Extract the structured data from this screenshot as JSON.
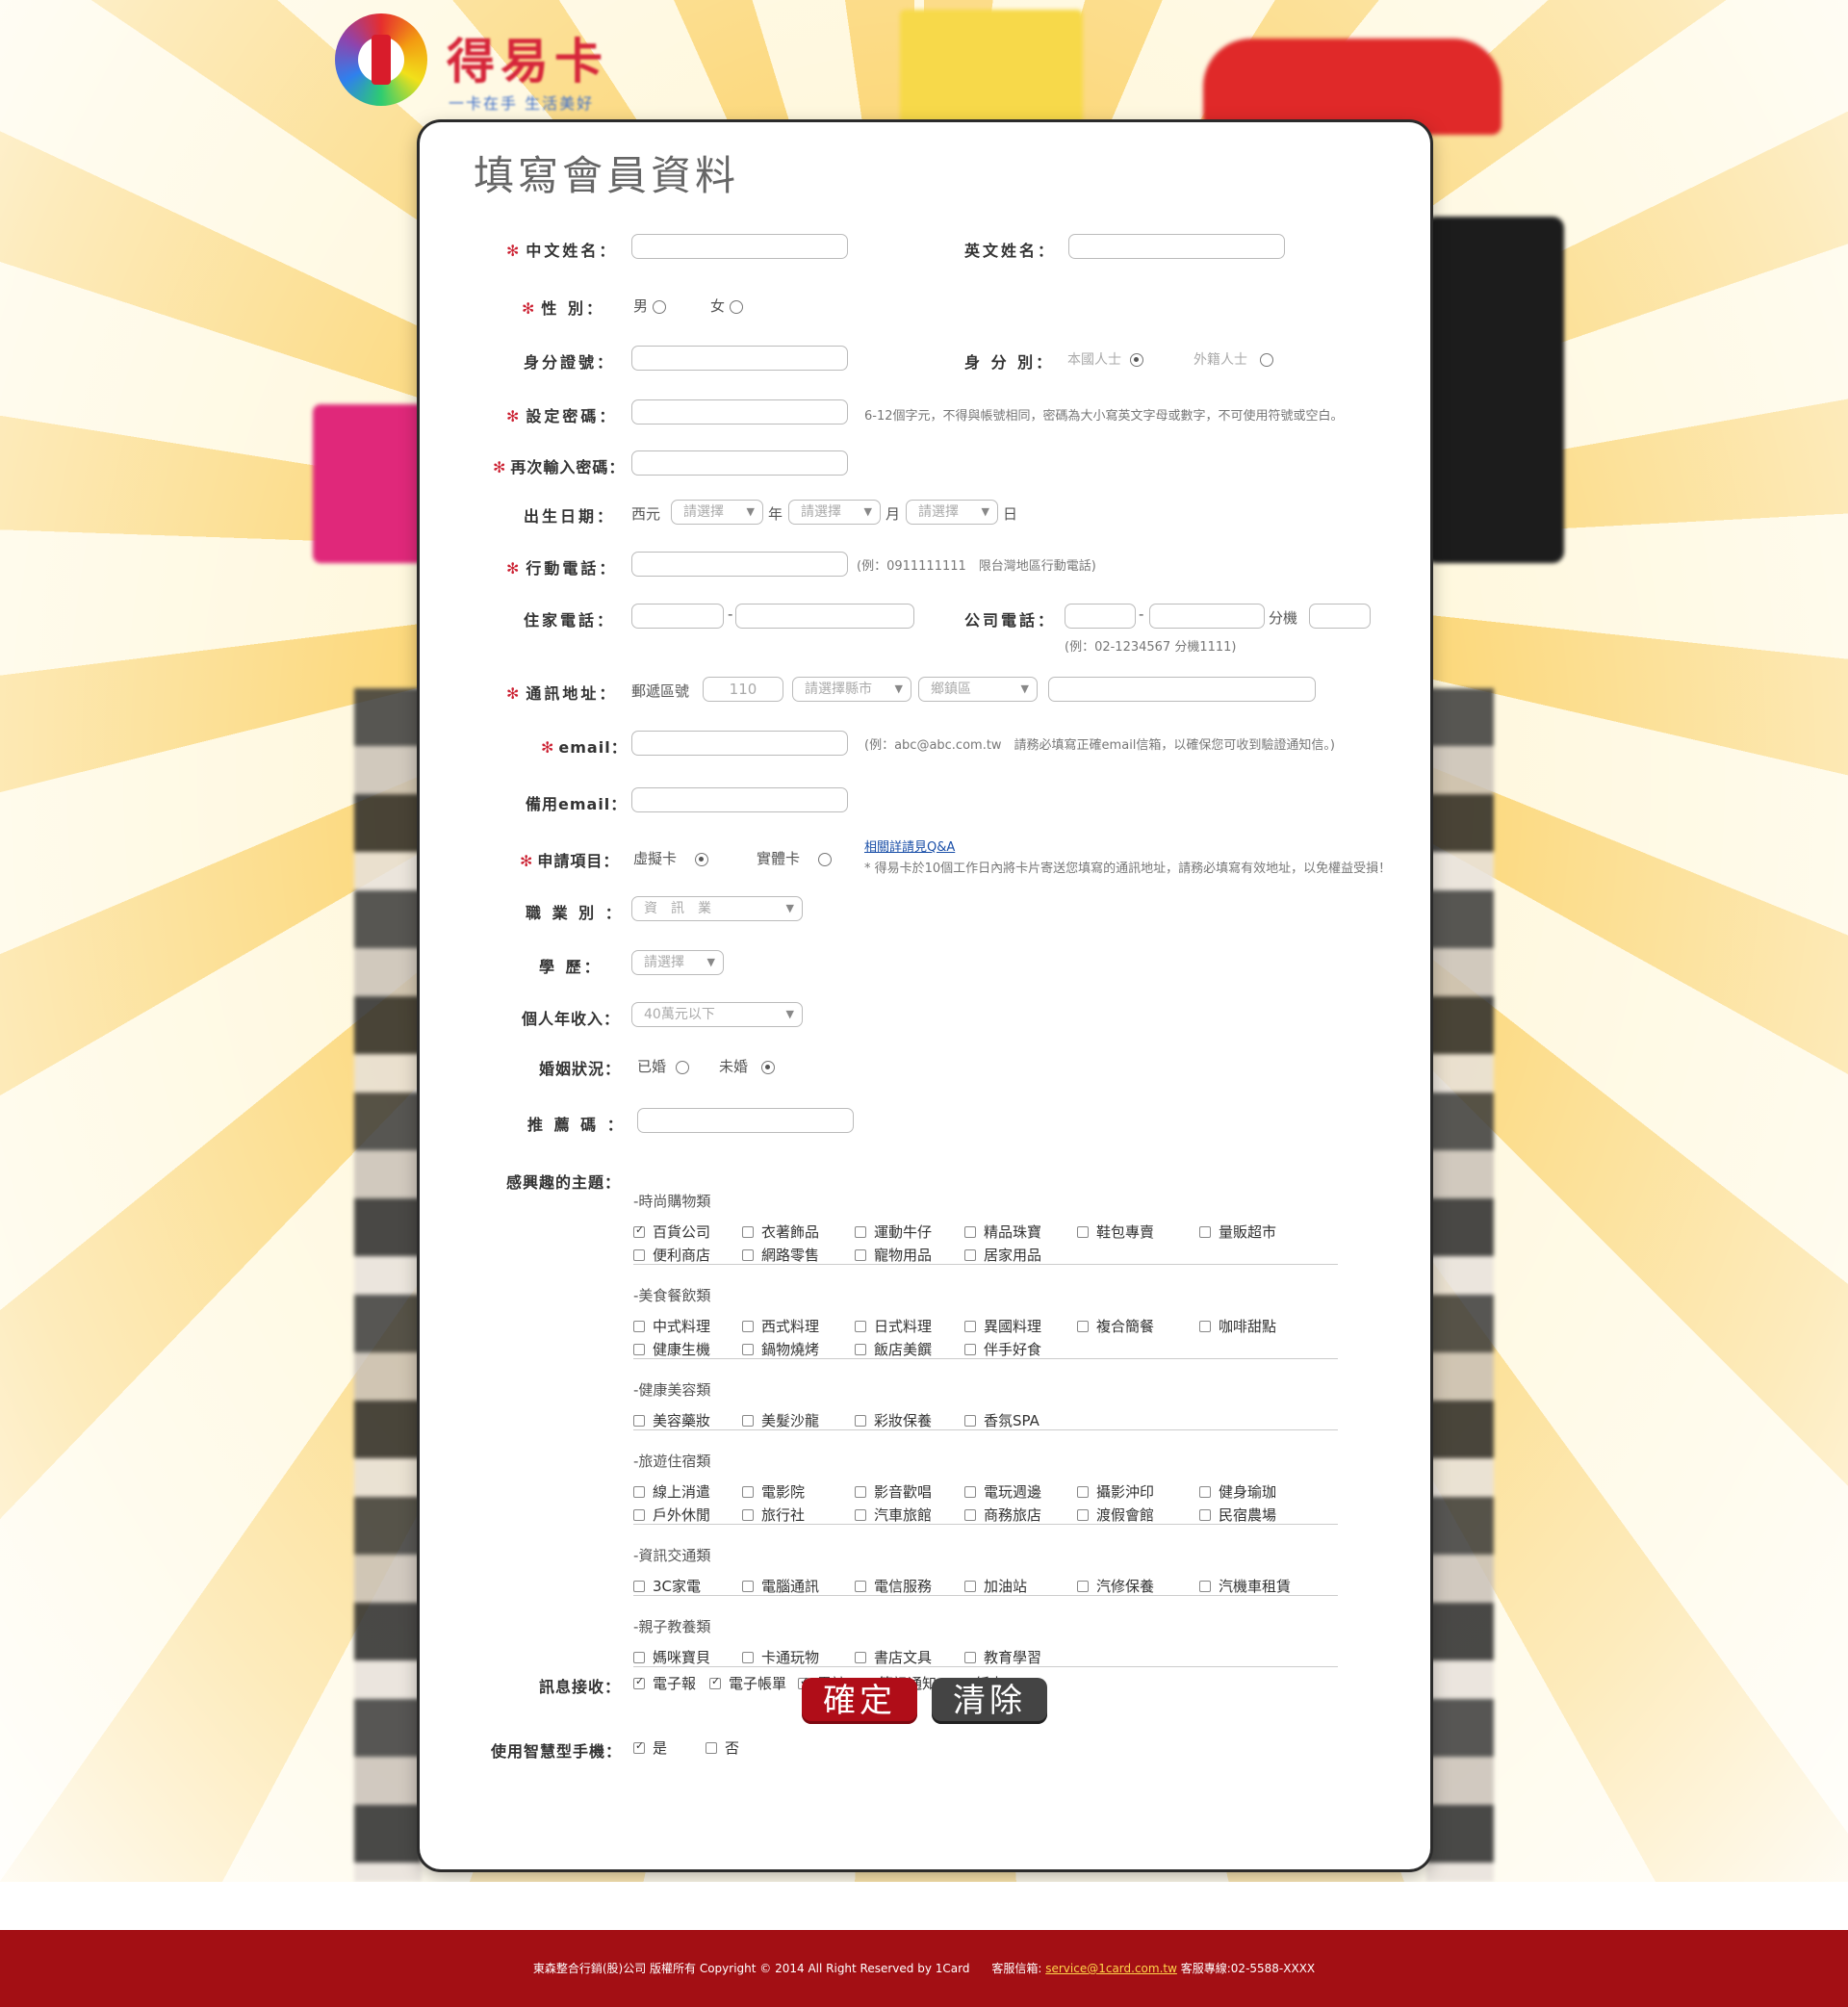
{
  "logo": {
    "text": "得易卡",
    "sub": "一卡在手 生活美好"
  },
  "page_title": "填寫會員資料",
  "labels": {
    "chinese_name": "中文姓名：",
    "english_name": "英文姓名：",
    "gender": "性 別：",
    "id_number": "身分證號：",
    "identity": "身 分 別：",
    "password": "設定密碼：",
    "password_confirm": "再次輸入密碼：",
    "birthday": "出生日期：",
    "mobile": "行動電話：",
    "home_phone": "住家電話：",
    "office_phone": "公司電話：",
    "address": "通訊地址：",
    "email": "email：",
    "backup_email": "備用email：",
    "apply_item": "申請項目：",
    "occupation": "職 業 別 ：",
    "education": "學 歷：",
    "income": "個人年收入：",
    "marital": "婚姻狀況：",
    "referral": "推 薦 碼 ：",
    "interests": "感興趣的主題：",
    "notifications": "訊息接收：",
    "smartphone": "使用智慧型手機："
  },
  "gender": {
    "male": "男",
    "female": "女"
  },
  "identity": {
    "local": "本國人士",
    "foreign": "外籍人士"
  },
  "password_hint": "6-12個字元，不得與帳號相同，密碼為大小寫英文字母或數字，不可使用符號或空白。",
  "birthday": {
    "prefix": "西元",
    "year_unit": "年",
    "month_unit": "月",
    "day_unit": "日",
    "placeholder": "請選擇"
  },
  "mobile_hint": "(例：0911111111　限台灣地區行動電話)",
  "office_phone": {
    "ext_label": "分機",
    "hint": "(例：02-1234567 分機1111)",
    "dash": "-"
  },
  "address": {
    "zip_label": "郵遞區號",
    "zip_value": "110",
    "city_placeholder": "請選擇縣市",
    "district_placeholder": "鄉鎮區"
  },
  "email_hint": "(例：abc@abc.com.tw　請務必填寫正確email信箱，以確保您可收到驗證通知信。)",
  "apply": {
    "virtual": "虛擬卡",
    "physical": "實體卡",
    "qa_link": "相關詳請見Q&A",
    "note": "* 得易卡於10個工作日內將卡片寄送您填寫的通訊地址，請務必填寫有效地址，以免權益受損！"
  },
  "occupation_value": "資　訊　業",
  "education_value": "請選擇",
  "income_value": "40萬元以下",
  "marital": {
    "married": "已婚",
    "single": "未婚"
  },
  "interest_categories": [
    {
      "title": "-時尚購物類",
      "items": [
        [
          "百貨公司",
          "衣著飾品",
          "運動牛仔",
          "精品珠寶",
          "鞋包專賣",
          "量販超市"
        ],
        [
          "便利商店",
          "網路零售",
          "寵物用品",
          "居家用品"
        ]
      ]
    },
    {
      "title": "-美食餐飲類",
      "items": [
        [
          "中式料理",
          "西式料理",
          "日式料理",
          "異國料理",
          "複合簡餐",
          "咖啡甜點"
        ],
        [
          "健康生機",
          "鍋物燒烤",
          "飯店美饌",
          "伴手好食"
        ]
      ]
    },
    {
      "title": "-健康美容類",
      "items": [
        [
          "美容藥妝",
          "美髮沙龍",
          "彩妝保養",
          "香氛SPA"
        ]
      ]
    },
    {
      "title": "-旅遊住宿類",
      "items": [
        [
          "線上消遣",
          "電影院",
          "影音歡唱",
          "電玩週邊",
          "攝影沖印",
          "健身瑜珈"
        ],
        [
          "戶外休閒",
          "旅行社",
          "汽車旅館",
          "商務旅店",
          "渡假會館",
          "民宿農場"
        ]
      ]
    },
    {
      "title": "-資訊交通類",
      "items": [
        [
          "3C家電",
          "電腦通訊",
          "電信服務",
          "加油站",
          "汽修保養",
          "汽機車租賃"
        ]
      ]
    },
    {
      "title": "-親子教養類",
      "items": [
        [
          "媽咪寶貝",
          "卡通玩物",
          "書店文具",
          "教育學習"
        ]
      ]
    }
  ],
  "notifications": [
    "電子報",
    "電子帳單",
    "電訪",
    "簡訊通知",
    "紙本DM"
  ],
  "smartphone": {
    "yes": "是",
    "no": "否"
  },
  "buttons": {
    "confirm": "確定",
    "clear": "清除"
  },
  "footer": {
    "copyright": "東森整合行銷(股)公司 版權所有 Copyright © 2014 All Right Reserved by 1Card",
    "service_mail_label": "客服信箱:",
    "service_mail": "service@1card.com.tw",
    "hotline": "客服專線:02-5588-XXXX"
  }
}
